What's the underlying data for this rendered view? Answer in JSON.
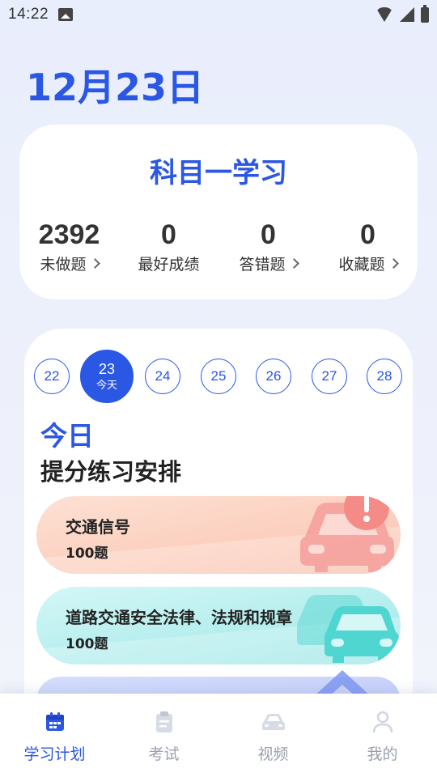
{
  "status_bar": {
    "time": "14:22"
  },
  "date_title": "12月23日",
  "subject": {
    "title": "科目一学习",
    "stats": [
      {
        "value": "2392",
        "label": "未做题",
        "has_arrow": true
      },
      {
        "value": "0",
        "label": "最好成绩",
        "has_arrow": false
      },
      {
        "value": "0",
        "label": "答错题",
        "has_arrow": true
      },
      {
        "value": "0",
        "label": "收藏题",
        "has_arrow": true
      }
    ]
  },
  "calendar": {
    "days": [
      {
        "num": "22"
      },
      {
        "num": "23",
        "sub": "今天",
        "active": true
      },
      {
        "num": "24"
      },
      {
        "num": "25"
      },
      {
        "num": "26"
      },
      {
        "num": "27"
      },
      {
        "num": "28"
      }
    ]
  },
  "plan": {
    "today_label": "今日",
    "heading": "提分练习安排",
    "tasks": [
      {
        "title": "交通信号",
        "count": "100题",
        "accent": "#f79b92"
      },
      {
        "title": "道路交通安全法律、法规和规章",
        "count": "100题",
        "accent": "#4fd6d0"
      }
    ]
  },
  "nav": {
    "items": [
      {
        "label": "学习计划",
        "icon": "calendar-icon",
        "active": true
      },
      {
        "label": "考试",
        "icon": "clipboard-icon"
      },
      {
        "label": "视频",
        "icon": "car-icon"
      },
      {
        "label": "我的",
        "icon": "person-icon"
      }
    ]
  },
  "colors": {
    "primary": "#2a57e3",
    "inactive": "#9aa0ad"
  }
}
